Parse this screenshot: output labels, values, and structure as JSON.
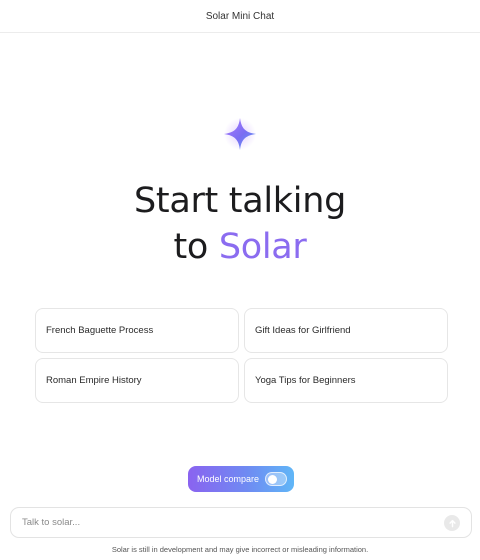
{
  "app": {
    "title": "Solar Mini Chat"
  },
  "hero": {
    "line1": "Start talking",
    "line2_prefix": "to ",
    "line2_accent": "Solar",
    "accent_color": "#8b6cf0"
  },
  "suggestions": [
    {
      "label": "French Baguette Process"
    },
    {
      "label": "Gift Ideas for Girlfriend"
    },
    {
      "label": "Roman Empire History"
    },
    {
      "label": "Yoga Tips for Beginners"
    }
  ],
  "model_compare": {
    "label": "Model compare",
    "enabled": false
  },
  "composer": {
    "placeholder": "Talk to solar...",
    "value": ""
  },
  "footer": {
    "disclaimer": "Solar is still in development and may give incorrect or misleading information."
  },
  "icons": {
    "logo": "sparkle-icon",
    "send": "send-arrow-icon"
  }
}
